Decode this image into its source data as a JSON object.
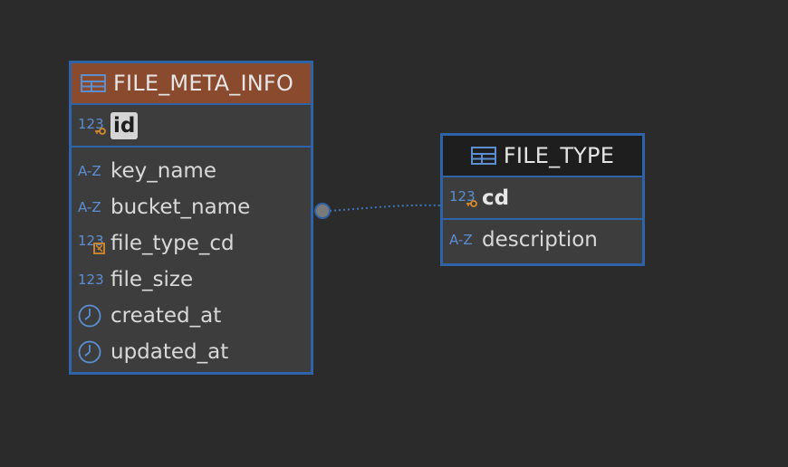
{
  "colors": {
    "background": "#2b2b2b",
    "border": "#2f63a8",
    "header_meta": "#8a4a2d",
    "header_type": "#1e1e1e",
    "type_icon": "#5b8fd1",
    "key_icon": "#d98a2b"
  },
  "entities": {
    "file_meta_info": {
      "title": "FILE_META_INFO",
      "pk": {
        "name": "id",
        "type_label": "123",
        "icon": "primary-key-icon"
      },
      "attributes": [
        {
          "name": "key_name",
          "type_label": "A-Z",
          "icon": "string-type-icon"
        },
        {
          "name": "bucket_name",
          "type_label": "A-Z",
          "icon": "string-type-icon"
        },
        {
          "name": "file_type_cd",
          "type_label": "123",
          "icon": "foreign-key-icon"
        },
        {
          "name": "file_size",
          "type_label": "123",
          "icon": "number-type-icon"
        },
        {
          "name": "created_at",
          "type_label": "",
          "icon": "clock-icon"
        },
        {
          "name": "updated_at",
          "type_label": "",
          "icon": "clock-icon"
        }
      ]
    },
    "file_type": {
      "title": "FILE_TYPE",
      "pk": {
        "name": "cd",
        "type_label": "123",
        "icon": "primary-key-icon"
      },
      "attributes": [
        {
          "name": "description",
          "type_label": "A-Z",
          "icon": "string-type-icon"
        }
      ]
    }
  },
  "relations": [
    {
      "from": "file_meta_info",
      "to": "file_type",
      "style": "dotted"
    }
  ]
}
